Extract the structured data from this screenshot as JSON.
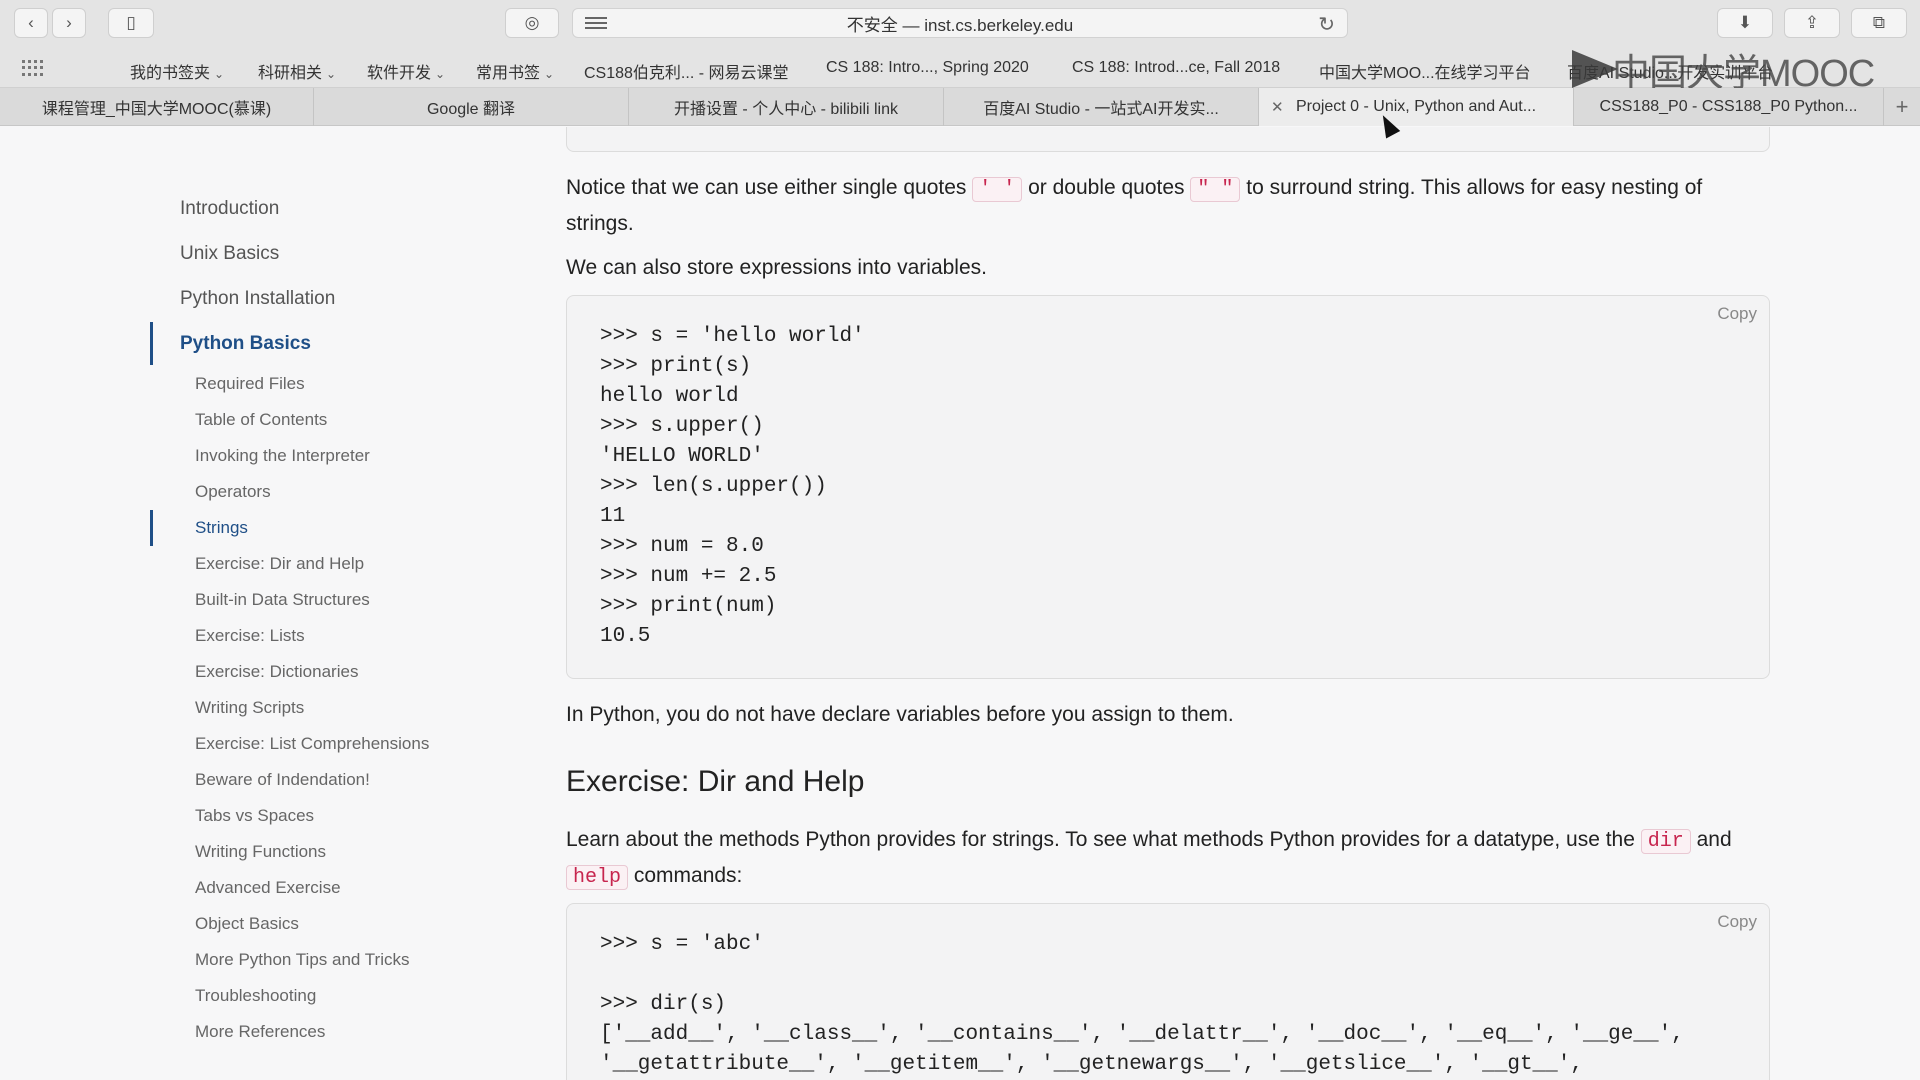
{
  "browser": {
    "address": "不安全 — inst.cs.berkeley.edu",
    "bookmarks": [
      {
        "label": "我的书签夹",
        "chevron": true
      },
      {
        "label": "科研相关",
        "chevron": true
      },
      {
        "label": "软件开发",
        "chevron": true
      },
      {
        "label": "常用书签",
        "chevron": true
      },
      {
        "label": "CS188伯克利... - 网易云课堂",
        "chevron": false
      },
      {
        "label": "CS 188: Intro..., Spring 2020",
        "chevron": false
      },
      {
        "label": "CS 188: Introd...ce, Fall 2018",
        "chevron": false
      },
      {
        "label": "中国大学MOO...在线学习平台",
        "chevron": false
      },
      {
        "label": "百度AI Studio...开发实训平台",
        "chevron": false
      }
    ],
    "watermark": "中国大学MOOC",
    "tabs": [
      {
        "label": "课程管理_中国大学MOOC(慕课)"
      },
      {
        "label": "Google 翻译"
      },
      {
        "label": "开播设置 - 个人中心 - bilibili link"
      },
      {
        "label": "百度AI Studio - 一站式AI开发实..."
      },
      {
        "label": "Project 0 - Unix, Python and Aut...",
        "active": true
      },
      {
        "label": "CSS188_P0 - CSS188_P0 Python..."
      }
    ]
  },
  "sidebar": {
    "top_items": [
      "Introduction",
      "Unix Basics",
      "Python Installation",
      "Python Basics"
    ],
    "active_top": "Python Basics",
    "sub_items": [
      "Required Files",
      "Table of Contents",
      "Invoking the Interpreter",
      "Operators",
      "Strings",
      "Exercise: Dir and Help",
      "Built-in Data Structures",
      "Exercise: Lists",
      "Exercise: Dictionaries",
      "Writing Scripts",
      "Exercise: List Comprehensions",
      "Beware of Indendation!",
      "Tabs vs Spaces",
      "Writing Functions",
      "Advanced Exercise",
      "Object Basics",
      "More Python Tips and Tricks",
      "Troubleshooting",
      "More References"
    ],
    "active_sub": "Strings"
  },
  "content": {
    "p1": {
      "a": "Notice that we can use either single quotes ",
      "code1": "' '",
      "b": " or double quotes ",
      "code2": "\" \"",
      "c": " to surround string. This allows for easy nesting of strings."
    },
    "p2": "We can also store expressions into variables.",
    "copy_label": "Copy",
    "code1": ">>> s = 'hello world'\n>>> print(s)\nhello world\n>>> s.upper()\n'HELLO WORLD'\n>>> len(s.upper())\n11\n>>> num = 8.0\n>>> num += 2.5\n>>> print(num)\n10.5",
    "p3": "In Python, you do not have declare variables before you assign to them.",
    "h2": "Exercise: Dir and Help",
    "p4": {
      "a": "Learn about the methods Python provides for strings. To see what methods Python provides for a datatype, use the ",
      "code1": "dir",
      "b": " and ",
      "code2": "help",
      "c": " commands:"
    },
    "code2": ">>> s = 'abc'\n\n>>> dir(s)\n['__add__', '__class__', '__contains__', '__delattr__', '__doc__', '__eq__', '__ge__',\n'__getattribute__', '__getitem__', '__getnewargs__', '__getslice__', '__gt__',"
  }
}
